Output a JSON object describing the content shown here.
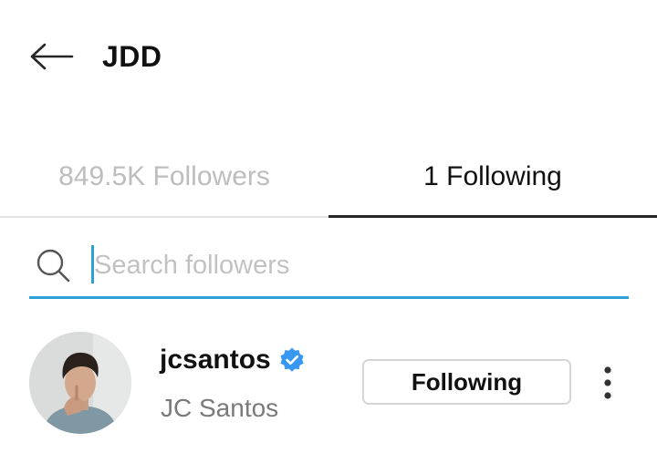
{
  "header": {
    "title": "JDD",
    "back_icon": "arrow-left-icon"
  },
  "tabs": [
    {
      "label": "849.5K Followers",
      "active": false
    },
    {
      "label": "1 Following",
      "active": true
    }
  ],
  "search": {
    "placeholder": "Search followers",
    "value": "",
    "icon": "search-icon"
  },
  "list": [
    {
      "username": "jcsantos",
      "full_name": "JC Santos",
      "verified": true,
      "button_label": "Following",
      "more_icon": "more-vertical-icon"
    }
  ],
  "colors": {
    "accent": "#2ea1d6",
    "verified": "#3897f0",
    "inactive_tab": "#bdbdbd",
    "secondary_text": "#7a7a7a"
  }
}
